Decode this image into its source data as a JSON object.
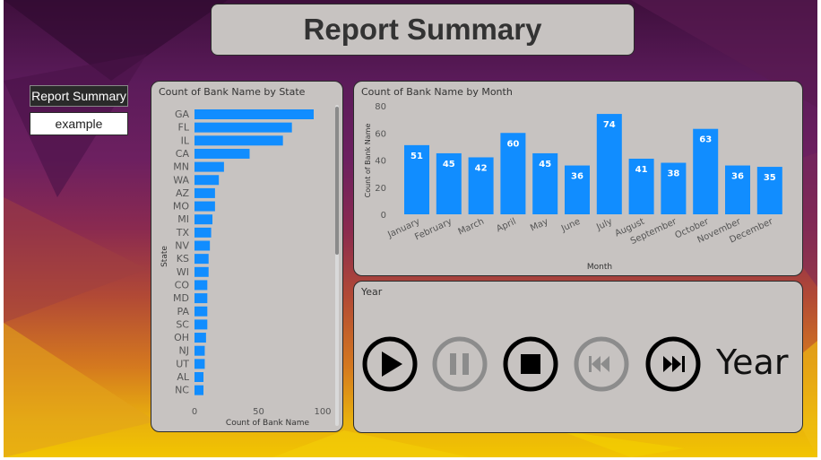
{
  "header": {
    "title": "Report Summary"
  },
  "slicer": {
    "header": "Report Summary",
    "item": "example"
  },
  "state_chart": {
    "title": "Count of Bank Name by State"
  },
  "month_chart": {
    "title": "Count of Bank Name by Month"
  },
  "year_panel": {
    "title": "Year",
    "label": "Year"
  },
  "colors": {
    "bar": "#118dff",
    "panel": "#c7c3c1",
    "title_text": "#333333",
    "disabled": "#8c8c8c"
  },
  "icons": [
    "play-icon",
    "pause-icon",
    "stop-icon",
    "skip-back-icon",
    "skip-forward-icon"
  ],
  "chart_data": [
    {
      "type": "bar",
      "orientation": "horizontal",
      "title": "Count of Bank Name by State",
      "xlabel": "Count of Bank Name",
      "ylabel": "State",
      "categories": [
        "GA",
        "FL",
        "IL",
        "CA",
        "MN",
        "WA",
        "AZ",
        "MO",
        "MI",
        "TX",
        "NV",
        "KS",
        "WI",
        "CO",
        "MD",
        "PA",
        "SC",
        "OH",
        "NJ",
        "UT",
        "AL",
        "NC"
      ],
      "values": [
        93,
        76,
        69,
        43,
        23,
        19,
        16,
        16,
        14,
        13,
        12,
        11,
        11,
        10,
        10,
        10,
        10,
        9,
        8,
        8,
        7,
        7
      ],
      "xlim": [
        0,
        100
      ],
      "xticks": [
        0,
        50,
        100
      ]
    },
    {
      "type": "bar",
      "title": "Count of Bank Name by Month",
      "xlabel": "Month",
      "ylabel": "Count of Bank Name",
      "categories": [
        "January",
        "February",
        "March",
        "April",
        "May",
        "June",
        "July",
        "August",
        "September",
        "October",
        "November",
        "December"
      ],
      "values": [
        51,
        45,
        42,
        60,
        45,
        36,
        74,
        41,
        38,
        63,
        36,
        35
      ],
      "ylim": [
        0,
        80
      ],
      "yticks": [
        0,
        20,
        40,
        60,
        80
      ]
    }
  ]
}
